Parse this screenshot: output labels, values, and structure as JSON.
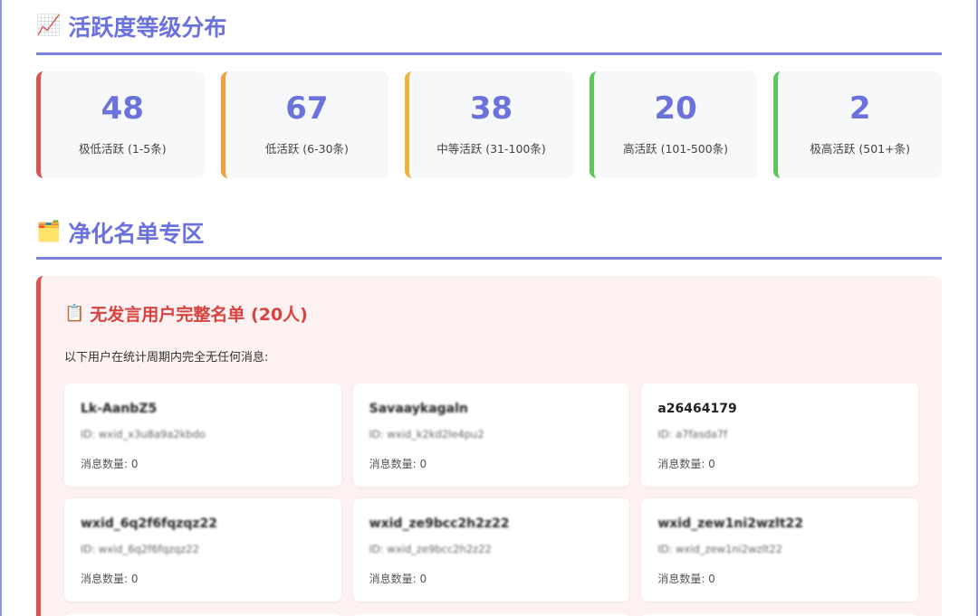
{
  "activity": {
    "emoji": "📈",
    "title": "活跃度等级分布",
    "stats": [
      {
        "value": "48",
        "label": "极低活跃 (1-5条)",
        "color": "#d9534f"
      },
      {
        "value": "67",
        "label": "低活跃 (6-30条)",
        "color": "#f0a03c"
      },
      {
        "value": "38",
        "label": "中等活跃 (31-100条)",
        "color": "#f0b43c"
      },
      {
        "value": "20",
        "label": "高活跃 (101-500条)",
        "color": "#5cc85c"
      },
      {
        "value": "2",
        "label": "极高活跃 (501+条)",
        "color": "#5cc85c"
      }
    ]
  },
  "purify": {
    "emoji": "🗂️",
    "title": "净化名单专区",
    "panel": {
      "emoji": "📋",
      "title": "无发言用户完整名单 (20人)",
      "desc": "以下用户在统计周期内完全无任何消息:",
      "users": [
        {
          "name": "Lk-AanbZ5",
          "id": "ID: wxid_x3u8a9a2kbdo",
          "count": "消息数量: 0"
        },
        {
          "name": "Savaaykagaln",
          "id": "ID: wxid_k2kd2le4pu2",
          "count": "消息数量: 0"
        },
        {
          "name": "a26464179",
          "id": "ID: a7fasda7f",
          "count": "消息数量: 0"
        },
        {
          "name": "wxid_6q2f6fqzqz22",
          "id": "ID: wxid_6q2f6fqzqz22",
          "count": "消息数量: 0"
        },
        {
          "name": "wxid_ze9bcc2h2z22",
          "id": "ID: wxid_ze9bcc2h2z22",
          "count": "消息数量: 0"
        },
        {
          "name": "wxid_zew1ni2wzlt22",
          "id": "ID: wxid_zew1ni2wzlt22",
          "count": "消息数量: 0"
        }
      ]
    }
  }
}
